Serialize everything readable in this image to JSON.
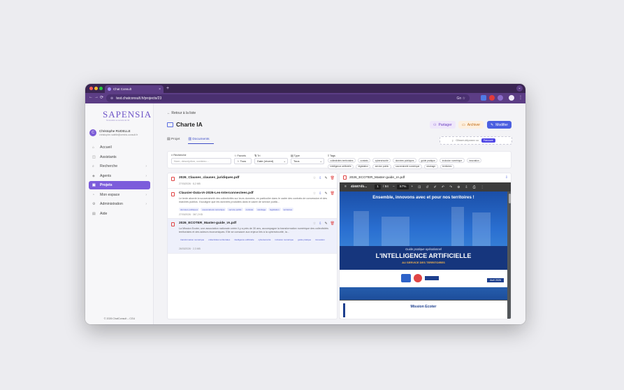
{
  "browser": {
    "tab_title": "Chat Consult",
    "tab_close": "×",
    "new_tab": "+",
    "url": "test.chatconsult.fr/projects/23",
    "url_right": "Gn ☆",
    "nav": [
      "←",
      "→",
      "⟳"
    ]
  },
  "sidebar": {
    "logo": "SAPENSIA",
    "logo_sub": "l'innovation au service de l'IA",
    "user": {
      "initial": "C",
      "name": "Christophe RUDELLE",
      "email": "christophe.rudelle@centric-consult.fr"
    },
    "items": [
      {
        "label": "Accueil",
        "icon": "⌂",
        "chevron": ""
      },
      {
        "label": "Assistants",
        "icon": "◫",
        "chevron": ""
      },
      {
        "label": "Recherche",
        "icon": "⌕",
        "chevron": "›"
      },
      {
        "label": "Agents",
        "icon": "◈",
        "chevron": "›"
      },
      {
        "label": "Projets",
        "icon": "▣",
        "chevron": ""
      },
      {
        "label": "Mon espace",
        "icon": "◔",
        "chevron": "›"
      },
      {
        "label": "Administration",
        "icon": "⚙",
        "chevron": "›"
      },
      {
        "label": "Aide",
        "icon": "▤",
        "chevron": ""
      }
    ],
    "active_index": 4,
    "copyright": "© 2026 ChatConsult – CGU"
  },
  "main": {
    "back": "← Retour à la liste",
    "title": "Charte IA",
    "buttons": {
      "share": "Partager",
      "archive": "Archiver",
      "edit": "Modifier"
    },
    "tabs": [
      {
        "label": "Projet",
        "icon": "▤"
      },
      {
        "label": "Documents",
        "icon": "▥"
      }
    ],
    "dropzone": {
      "text": "Glisser-déposez ou",
      "button": "Parcourir"
    }
  },
  "filters": {
    "search_label": "Recherche",
    "search_placeholder": "Nom, description, contenu...",
    "favoris_label": "Favoris",
    "favoris_value": "☆ Tous",
    "tri_label": "Tri",
    "tri_value": "Date (récent)",
    "type_label": "Type",
    "type_value": "Tous",
    "tags_label": "Tags",
    "tags": [
      "collectivités territoriales",
      "contrats",
      "cybersécurité",
      "données publiques",
      "guide pratique",
      "inclusion numérique",
      "innovation",
      "intelligence artificielle",
      "législation",
      "service public",
      "souveraineté numérique",
      "stockage",
      "territoires"
    ]
  },
  "documents": [
    {
      "name": "2026_Clauses_clauses_juridiques.pdf",
      "desc": "",
      "tags": [],
      "meta": "27/03/2026 · 8,2 MB"
    },
    {
      "name": "Clausier-Data-IA-2026-Les-Interconnectees.pdf",
      "desc": "Le texte aborde la souveraineté des collectivités sur leurs données, en particulier dans le cadre des contrats de concession et des marchés publics. Il souligne que les données produites dans le cadre de service public...",
      "tags": [
        "données publiques",
        "souveraineté numérique",
        "service public",
        "contrats",
        "stockage",
        "législation",
        "territoires"
      ],
      "meta": "27/03/2026 · 367,2 KB"
    },
    {
      "name": "2026_ECOTER_Master-guide_IA.pdf",
      "desc": "La Mission Ecoter, une association nationale créée il y a près de 30 ans, accompagne la transformation numérique des collectivités territoriales et des acteurs économiques. Elle se consacre aux enjeux liés à la cybersécurité, la...",
      "tags": [
        "transformation numérique",
        "collectivités territoriales",
        "intelligence artificielle",
        "cybersécurité",
        "inclusion numérique",
        "guide pratique",
        "innovation"
      ],
      "meta": "26/03/2026 · 2,3 MB"
    }
  ],
  "viewer": {
    "file": "2026_ECOTER_Master-guide_IA.pdf",
    "doc_id": "4b587db...",
    "page": "1",
    "pages": "/ 84",
    "zoom": "57%",
    "cover_headline": "Ensemble, innovons avec et pour nos territoires !",
    "cover_sub": "Guide pratique opérationnel",
    "cover_title": "L'INTELLIGENCE ARTIFICIELLE",
    "cover_service": "AU SERVICE DES TERRITOIRES",
    "cover_date": "Avril 2026",
    "page2_heading": "Mission Ecoter"
  }
}
